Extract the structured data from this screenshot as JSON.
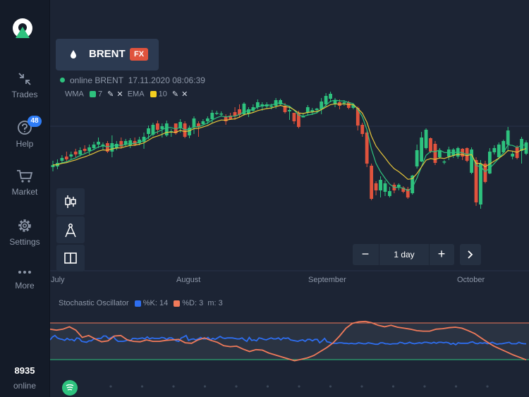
{
  "sidebar": {
    "items": [
      {
        "label": "Trades",
        "icon": "arrows-collapse-icon"
      },
      {
        "label": "Help",
        "icon": "help-icon",
        "badge": "48"
      },
      {
        "label": "Market",
        "icon": "cart-icon"
      },
      {
        "label": "Settings",
        "icon": "gear-icon"
      },
      {
        "label": "More",
        "icon": "more-dots-icon"
      }
    ],
    "online_count": "8935",
    "online_label": "online"
  },
  "asset": {
    "name": "BRENT",
    "tag": "FX",
    "tag_color": "#e0533d"
  },
  "status": {
    "text": "online BRENT",
    "datetime": "17.11.2020 08:06:39"
  },
  "indicators": [
    {
      "name": "WMA",
      "period": "7",
      "color": "#2ec27e"
    },
    {
      "name": "EMA",
      "period": "10",
      "color": "#f5d020"
    }
  ],
  "tools": [
    {
      "name": "chart-type",
      "icon": "candlestick-icon"
    },
    {
      "name": "drawing",
      "icon": "compass-icon"
    },
    {
      "name": "layout",
      "icon": "split-panel-icon"
    }
  ],
  "zoom": {
    "minus": "−",
    "label": "1 day",
    "plus": "+"
  },
  "months": [
    "July",
    "August",
    "September",
    "October"
  ],
  "oscillator": {
    "title": "Stochastic Oscillator",
    "k_label": "%K: 14",
    "k_color": "#2e6ef0",
    "d_label": "%D: 3",
    "d_color": "#f07a5a",
    "m_label": "m: 3"
  },
  "chart_data": {
    "type": "candlestick",
    "up_color": "#2ec27e",
    "down_color": "#e0533d",
    "candles": [
      [
        "u",
        237,
        234,
        243,
        228
      ],
      [
        "u",
        236,
        231,
        240,
        226
      ],
      [
        "u",
        228,
        224,
        231,
        220
      ],
      [
        "d",
        222,
        226,
        230,
        215
      ],
      [
        "u",
        222,
        219,
        226,
        215
      ],
      [
        "d",
        215,
        219,
        223,
        211
      ],
      [
        "u",
        219,
        213,
        222,
        209
      ],
      [
        "d",
        211,
        214,
        218,
        206
      ],
      [
        "u",
        214,
        209,
        219,
        205
      ],
      [
        "u",
        210,
        205,
        213,
        201
      ],
      [
        "u",
        205,
        201,
        210,
        195
      ],
      [
        "u",
        207,
        205,
        212,
        202
      ],
      [
        "d",
        203,
        215,
        217,
        200
      ],
      [
        "u",
        215,
        203,
        223,
        192
      ],
      [
        "u",
        210,
        204,
        213,
        200
      ],
      [
        "d",
        200,
        208,
        211,
        195
      ],
      [
        "u",
        205,
        200,
        208,
        197
      ],
      [
        "u",
        206,
        199,
        210,
        196
      ],
      [
        "d",
        200,
        205,
        207,
        195
      ],
      [
        "u",
        203,
        198,
        206,
        194
      ],
      [
        "u",
        201,
        194,
        211,
        188
      ],
      [
        "u",
        190,
        182,
        197,
        178
      ],
      [
        "u",
        191,
        177,
        193,
        174
      ],
      [
        "d",
        175,
        184,
        190,
        171
      ],
      [
        "u",
        183,
        179,
        195,
        175
      ],
      [
        "u",
        192,
        175,
        194,
        171
      ],
      [
        "u",
        188,
        186,
        194,
        183
      ],
      [
        "d",
        175,
        189,
        191,
        175
      ],
      [
        "u",
        182,
        173,
        188,
        169
      ],
      [
        "d",
        175,
        194,
        196,
        172
      ],
      [
        "u",
        192,
        181,
        196,
        178
      ],
      [
        "u",
        180,
        168,
        190,
        165
      ],
      [
        "d",
        175,
        180,
        194,
        172
      ],
      [
        "u",
        176,
        172,
        178,
        169
      ],
      [
        "u",
        172,
        168,
        176,
        165
      ],
      [
        "u",
        169,
        160,
        174,
        156
      ],
      [
        "u",
        160,
        161,
        163,
        157
      ],
      [
        "u",
        162,
        161,
        164,
        158
      ],
      [
        "d",
        165,
        172,
        177,
        162
      ],
      [
        "d",
        169,
        164,
        170,
        160
      ],
      [
        "d",
        159,
        165,
        170,
        152
      ],
      [
        "d",
        163,
        155,
        167,
        148
      ],
      [
        "u",
        162,
        147,
        164,
        145
      ],
      [
        "u",
        161,
        155,
        166,
        152
      ],
      [
        "u",
        157,
        152,
        160,
        148
      ],
      [
        "u",
        152,
        145,
        155,
        141
      ],
      [
        "u",
        151,
        148,
        157,
        145
      ],
      [
        "u",
        151,
        148,
        154,
        145
      ],
      [
        "u",
        151,
        150,
        155,
        147
      ],
      [
        "u",
        150,
        142,
        154,
        139
      ],
      [
        "u",
        148,
        142,
        150,
        140
      ],
      [
        "d",
        150,
        159,
        161,
        146
      ],
      [
        "u",
        158,
        156,
        170,
        150
      ],
      [
        "d",
        160,
        172,
        176,
        160
      ],
      [
        "d",
        160,
        180,
        182,
        157
      ],
      [
        "u",
        165,
        165,
        166,
        160
      ],
      [
        "u",
        160,
        152,
        164,
        149
      ],
      [
        "u",
        159,
        156,
        163,
        153
      ],
      [
        "u",
        156,
        154,
        161,
        153
      ],
      [
        "u",
        155,
        144,
        162,
        139
      ],
      [
        "u",
        148,
        136,
        152,
        132
      ],
      [
        "u",
        140,
        133,
        145,
        130
      ],
      [
        "u",
        148,
        142,
        152,
        139
      ],
      [
        "d",
        145,
        150,
        155,
        141
      ],
      [
        "u",
        146,
        145,
        150,
        142
      ],
      [
        "d",
        145,
        153,
        155,
        143
      ],
      [
        "u",
        153,
        149,
        155,
        147
      ],
      [
        "d",
        153,
        178,
        185,
        151
      ],
      [
        "d",
        177,
        190,
        194,
        174
      ],
      [
        "d",
        188,
        232,
        237,
        185
      ],
      [
        "d",
        235,
        282,
        284,
        232
      ],
      [
        "d",
        260,
        270,
        277,
        257
      ],
      [
        "u",
        270,
        255,
        280,
        250
      ],
      [
        "u",
        272,
        260,
        278,
        256
      ],
      [
        "u",
        278,
        271,
        280,
        265
      ],
      [
        "d",
        262,
        270,
        274,
        259
      ],
      [
        "u",
        265,
        262,
        270,
        260
      ],
      [
        "d",
        266,
        272,
        274,
        264
      ],
      [
        "d",
        268,
        280,
        282,
        265
      ],
      [
        "u",
        274,
        249,
        276,
        248
      ],
      [
        "u",
        236,
        213,
        239,
        205
      ],
      [
        "u",
        229,
        195,
        230,
        187
      ],
      [
        "u",
        210,
        184,
        212,
        182
      ],
      [
        "d",
        196,
        215,
        217,
        195
      ],
      [
        "d",
        204,
        231,
        234,
        200
      ],
      [
        "u",
        223,
        214,
        225,
        210
      ],
      [
        "u",
        230,
        229,
        233,
        227
      ],
      [
        "u",
        222,
        212,
        227,
        208
      ],
      [
        "u",
        221,
        212,
        224,
        210
      ],
      [
        "u",
        222,
        210,
        225,
        208
      ],
      [
        "d",
        211,
        222,
        227,
        210
      ],
      [
        "d",
        210,
        228,
        230,
        209
      ],
      [
        "u",
        245,
        212,
        247,
        209
      ],
      [
        "d",
        227,
        287,
        292,
        223
      ],
      [
        "u",
        290,
        232,
        296,
        227
      ],
      [
        "d",
        232,
        258,
        260,
        228
      ],
      [
        "u",
        246,
        215,
        247,
        210
      ],
      [
        "u",
        216,
        210,
        219,
        206
      ],
      [
        "u",
        223,
        205,
        226,
        202
      ],
      [
        "u",
        216,
        200,
        217,
        198
      ],
      [
        "u",
        205,
        185,
        215,
        180
      ],
      [
        "u",
        222,
        218,
        226,
        215
      ],
      [
        "d",
        209,
        224,
        226,
        206
      ],
      [
        "u",
        214,
        197,
        232,
        194
      ],
      [
        "u",
        218,
        202,
        220,
        199
      ]
    ],
    "stochastic": {
      "k": [
        58,
        64,
        67,
        62,
        60,
        59,
        57,
        61,
        58,
        59,
        56,
        62,
        61,
        55,
        54,
        53,
        56,
        56,
        60,
        60,
        61,
        61,
        66,
        66,
        61,
        62,
        65,
        59,
        55,
        55,
        55,
        56,
        58,
        56,
        61,
        61,
        60,
        61,
        62,
        60,
        64,
        60,
        62,
        61,
        61,
        61,
        63,
        62,
        59,
        62,
        62,
        59,
        56,
        55,
        62,
        64,
        67,
        57,
        59,
        60,
        58,
        60,
        63,
        60,
        60,
        63,
        58,
        61,
        59,
        62,
        65,
        62,
        61,
        62,
        62,
        62,
        61,
        60,
        60,
        62,
        58,
        55,
        63,
        57,
        58,
        56,
        62,
        61,
        59,
        58,
        60,
        62,
        60,
        60,
        62,
        58,
        62,
        61,
        62,
        58,
        57,
        56,
        55,
        57,
        58,
        55,
        59,
        59,
        56,
        59,
        59,
        52,
        56,
        61,
        54,
        53,
        51,
        51,
        51,
        52,
        52,
        51,
        51,
        50,
        51,
        50,
        50,
        52,
        51,
        50,
        50,
        52,
        51,
        50,
        49,
        49,
        52,
        52,
        50,
        50,
        49,
        50,
        50,
        50,
        53,
        52,
        50,
        51,
        53,
        51,
        50,
        51,
        52,
        51,
        53,
        53,
        52,
        51,
        53,
        51,
        53,
        53,
        52,
        53,
        52,
        49,
        51,
        48,
        52,
        51,
        51,
        51,
        51,
        53,
        54,
        51,
        50,
        52,
        51,
        52,
        50,
        51,
        53,
        51,
        49,
        50,
        50,
        51,
        52,
        53,
        50,
        50,
        50,
        53,
        51,
        50,
        50
      ],
      "d": [
        80,
        78,
        80,
        85,
        78,
        63,
        67,
        60,
        54,
        56,
        66,
        67,
        58,
        55,
        54,
        58,
        55,
        55,
        57,
        58,
        59,
        52,
        51,
        58,
        62,
        57,
        53,
        46,
        44,
        45,
        39,
        34,
        38,
        37,
        31,
        27,
        23,
        19,
        15,
        18,
        21,
        26,
        34,
        42,
        52,
        66,
        82,
        92,
        95,
        96,
        93,
        88,
        85,
        88,
        84,
        82,
        80,
        77,
        76,
        76,
        80,
        81,
        83,
        84,
        82,
        77,
        71,
        62,
        53,
        45,
        39,
        33,
        27,
        22,
        17
      ]
    }
  }
}
